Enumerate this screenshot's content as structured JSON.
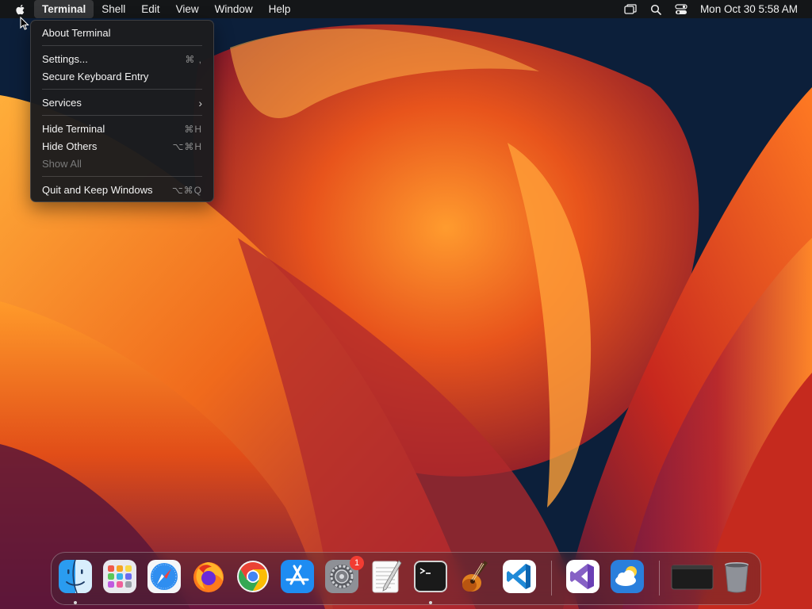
{
  "menubar": {
    "app_menu": "Terminal",
    "menus": [
      "Shell",
      "Edit",
      "View",
      "Window",
      "Help"
    ],
    "clock": "Mon Oct 30  5:58 AM",
    "status_icons": [
      "screen-mirroring-icon",
      "search-icon",
      "control-center-icon"
    ]
  },
  "dropdown": {
    "items": [
      {
        "label": "About Terminal",
        "shortcut": ""
      },
      {
        "label": "Settings...",
        "shortcut": "⌘ ,"
      },
      {
        "label": "Secure Keyboard Entry",
        "shortcut": ""
      },
      {
        "label": "Services",
        "shortcut": ""
      },
      {
        "label": "Hide Terminal",
        "shortcut": "⌘H"
      },
      {
        "label": "Hide Others",
        "shortcut": "⌥⌘H"
      },
      {
        "label": "Show All",
        "shortcut": "",
        "disabled": true
      },
      {
        "label": "Quit and Keep Windows",
        "shortcut": "⌥⌘Q"
      }
    ]
  },
  "dock": {
    "apps": [
      {
        "name": "Finder",
        "icon": "finder-icon",
        "running": true
      },
      {
        "name": "Launchpad",
        "icon": "launchpad-icon",
        "running": false
      },
      {
        "name": "Safari",
        "icon": "safari-icon",
        "running": false
      },
      {
        "name": "Firefox",
        "icon": "firefox-icon",
        "running": false
      },
      {
        "name": "Chrome",
        "icon": "chrome-icon",
        "running": false
      },
      {
        "name": "App Store",
        "icon": "app-store-icon",
        "running": false
      },
      {
        "name": "System Settings",
        "icon": "system-settings-icon",
        "running": false,
        "badge": "1"
      },
      {
        "name": "TextEdit",
        "icon": "textedit-icon",
        "running": false
      },
      {
        "name": "Terminal",
        "icon": "terminal-icon",
        "running": true
      },
      {
        "name": "GarageBand",
        "icon": "garageband-icon",
        "running": false
      },
      {
        "name": "Visual Studio Code",
        "icon": "vscode-icon",
        "running": false
      },
      {
        "name": "Visual Studio",
        "icon": "visual-studio-icon",
        "running": false
      },
      {
        "name": "Weather",
        "icon": "weather-icon",
        "running": false
      },
      {
        "name": "Minimized Window",
        "icon": "minimized-window-icon",
        "running": false
      },
      {
        "name": "Trash",
        "icon": "trash-icon",
        "running": false
      }
    ]
  },
  "colors": {
    "menu_bg": "#1c1c1e",
    "badge": "#f23c32",
    "wallpaper_orange": "#f5821f",
    "wallpaper_navy": "#0c1f3a"
  }
}
